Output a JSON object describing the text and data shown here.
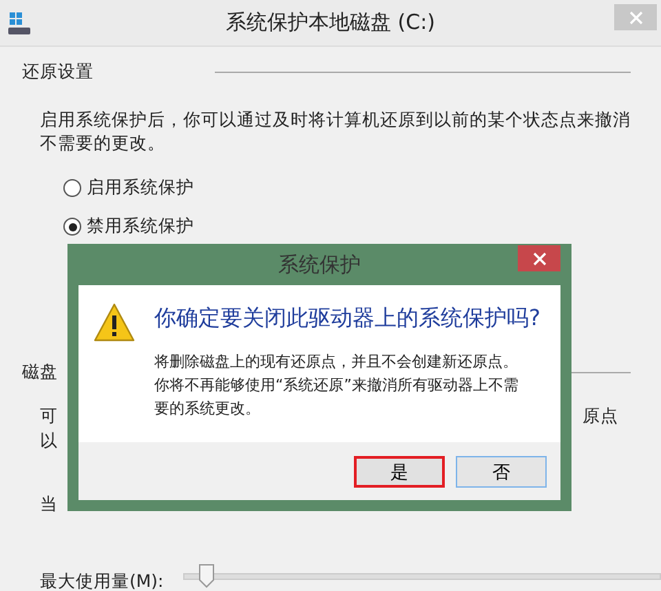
{
  "window": {
    "title": "系统保护本地磁盘 (C:)"
  },
  "restore_settings": {
    "heading": "还原设置",
    "description": "启用系统保护后，你可以通过及时将计算机还原到以前的某个状态点来撤消不需要的更改。",
    "options": [
      {
        "label": "启用系统保护",
        "selected": false
      },
      {
        "label": "禁用系统保护",
        "selected": true
      }
    ]
  },
  "disk_space": {
    "heading": "磁盘",
    "line_1_start": "可",
    "line_1_end": "原点",
    "line_2_start": "以",
    "current_usage_label": "当",
    "max_usage": {
      "label": "最大使用量(M):",
      "level": 0.05
    }
  },
  "dialog": {
    "title": "系统保护",
    "question": "你确定要关闭此驱动器上的系统保护吗?",
    "message": "将删除磁盘上的现有还原点，并且不会创建新还原点。你将不再能够使用“系统还原”来撤消所有驱动器上不需要的系统更改。",
    "buttons": [
      {
        "label": "是",
        "focused": true
      },
      {
        "label": "否",
        "focused": false
      }
    ]
  }
}
